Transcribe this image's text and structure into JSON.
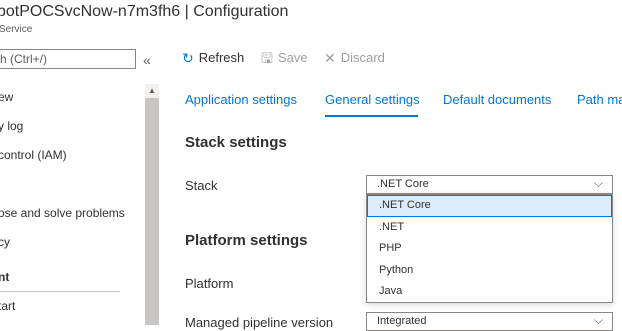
{
  "header": {
    "title": "botPOCSvcNow-n7m3fh6 | Configuration",
    "subtitle": "Service"
  },
  "sidebar": {
    "search_placeholder": "h (Ctrl+/)",
    "collapse_glyph": "«",
    "items": [
      {
        "label": "ew"
      },
      {
        "label": "y log"
      },
      {
        "label": "control (IAM)"
      },
      {
        "label": "ose and solve problems"
      },
      {
        "label": "cy"
      },
      {
        "label": "nt"
      },
      {
        "label": "tart"
      }
    ]
  },
  "toolbar": {
    "refresh_label": "Refresh",
    "save_label": "Save",
    "discard_label": "Discard"
  },
  "tabs": [
    {
      "label": "Application settings"
    },
    {
      "label": "General settings"
    },
    {
      "label": "Default documents"
    },
    {
      "label": "Path ma"
    }
  ],
  "stack_settings": {
    "title": "Stack settings",
    "stack_label": "Stack",
    "stack_value": ".NET Core",
    "options": [
      ".NET Core",
      ".NET",
      "PHP",
      "Python",
      "Java"
    ]
  },
  "platform_settings": {
    "title": "Platform settings",
    "platform_label": "Platform",
    "pipeline_label": "Managed pipeline version",
    "pipeline_value": "Integrated"
  },
  "colors": {
    "accent": "#0078d4",
    "selected_option_bg": "#deecf9"
  }
}
